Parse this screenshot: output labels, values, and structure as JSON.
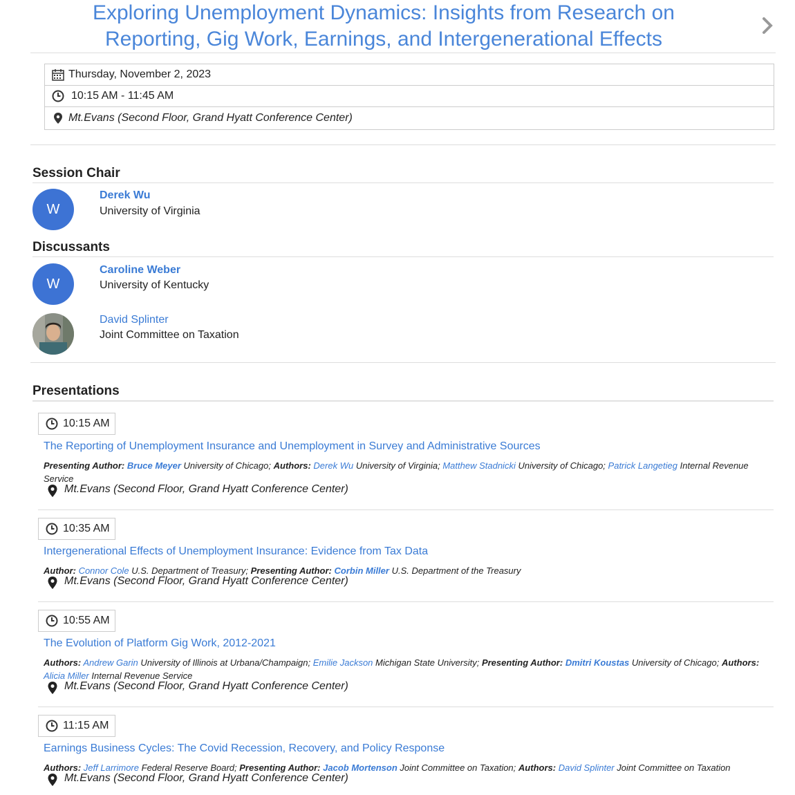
{
  "session": {
    "title_line1": "Exploring Unemployment Dynamics: Insights from Research on",
    "title_line2": "Reporting, Gig Work, Earnings, and Intergenerational Effects",
    "date": "Thursday, November 2, 2023",
    "time": "10:15 AM - 11:45 AM",
    "location": "Mt.Evans (Second Floor, Grand Hyatt Conference Center)"
  },
  "session_chair": {
    "heading": "Session Chair",
    "person": {
      "initial": "W",
      "name": "Derek Wu",
      "affiliation": "University of Virginia"
    }
  },
  "discussants": {
    "heading": "Discussants",
    "people": [
      {
        "initial": "W",
        "name": "Caroline Weber",
        "affiliation": "University of Kentucky"
      },
      {
        "name": "David Splinter",
        "affiliation": "Joint Committee on Taxation"
      }
    ]
  },
  "presentations": {
    "heading": "Presentations",
    "items": [
      {
        "time": "10:15 AM",
        "title": "The Reporting of Unemployment Insurance and Unemployment in Survey and Administrative Sources",
        "location": "Mt.Evans (Second Floor, Grand Hyatt Conference Center)",
        "a": {
          "l1": "Presenting Author:",
          "n1": "Bruce Meyer",
          "f1": "University of Chicago;",
          "l2": "Authors:",
          "n2": "Derek Wu",
          "f2": "University of Virginia;",
          "n3": "Matthew Stadnicki",
          "f3": "University of Chicago;",
          "n4": "Patrick Langetieg",
          "f4": "Internal Revenue Service"
        }
      },
      {
        "time": "10:35 AM",
        "title": "Intergenerational Effects of Unemployment Insurance: Evidence from Tax Data",
        "location": "Mt.Evans (Second Floor, Grand Hyatt Conference Center)",
        "a": {
          "l1": "Author:",
          "n1": "Connor Cole",
          "f1": "U.S. Department of Treasury;",
          "l2": "Presenting Author:",
          "n2": "Corbin Miller",
          "f2": "U.S. Department of the Treasury"
        }
      },
      {
        "time": "10:55 AM",
        "title": "The Evolution of Platform Gig Work, 2012-2021",
        "location": "Mt.Evans (Second Floor, Grand Hyatt Conference Center)",
        "a": {
          "l1": "Authors:",
          "n1": "Andrew Garin",
          "f1": "University of Illinois at Urbana/Champaign;",
          "n2": "Emilie Jackson",
          "f2": "Michigan State University;",
          "l3": "Presenting Author:",
          "n3": "Dmitri Koustas",
          "f3": "University of Chicago;",
          "l4": "Authors:",
          "n4": "Alicia Miller",
          "f4": "Internal Revenue Service"
        }
      },
      {
        "time": "11:15 AM",
        "title": "Earnings Business Cycles: The Covid Recession, Recovery, and Policy Response",
        "location": "Mt.Evans (Second Floor, Grand Hyatt Conference Center)",
        "a": {
          "l1": "Authors:",
          "n1": "Jeff Larrimore",
          "f1": "Federal Reserve Board;",
          "l2": "Presenting Author:",
          "n2": "Jacob Mortenson",
          "f2": "Joint Committee on Taxation;",
          "l3": "Authors:",
          "n3": "David Splinter",
          "f3": "Joint Committee on Taxation"
        }
      }
    ]
  },
  "icons": {
    "next": "chevron-right-icon",
    "calendar": "calendar-icon",
    "clock": "clock-icon",
    "pin": "map-pin-icon"
  }
}
